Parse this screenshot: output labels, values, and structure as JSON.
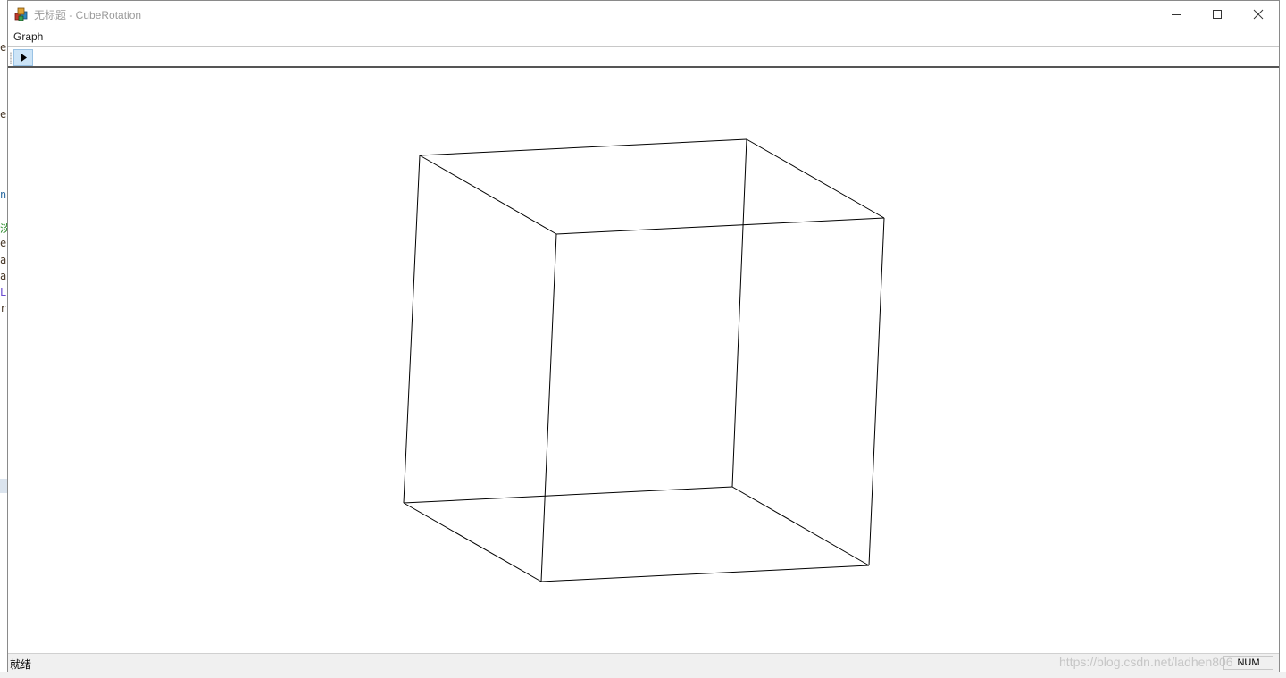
{
  "window": {
    "title": "无标题 - CubeRotation",
    "controls": {
      "minimize_icon": "minimize-icon",
      "maximize_icon": "maximize-icon",
      "close_icon": "close-icon"
    }
  },
  "menu": {
    "items": [
      "Graph"
    ]
  },
  "toolbar": {
    "play_icon": "play-icon"
  },
  "status": {
    "text": "就绪",
    "num_indicator": "NUM"
  },
  "watermark": "https://blog.csdn.net/ladhen806",
  "background_edge_chars": [
    "e",
    "e",
    "n",
    "淡",
    "e",
    "a",
    "a",
    "L",
    "r"
  ],
  "colors": {
    "cube_stroke": "#000000",
    "toolbar_button": "#cce4f7",
    "status_bar": "#f0f0f0"
  }
}
